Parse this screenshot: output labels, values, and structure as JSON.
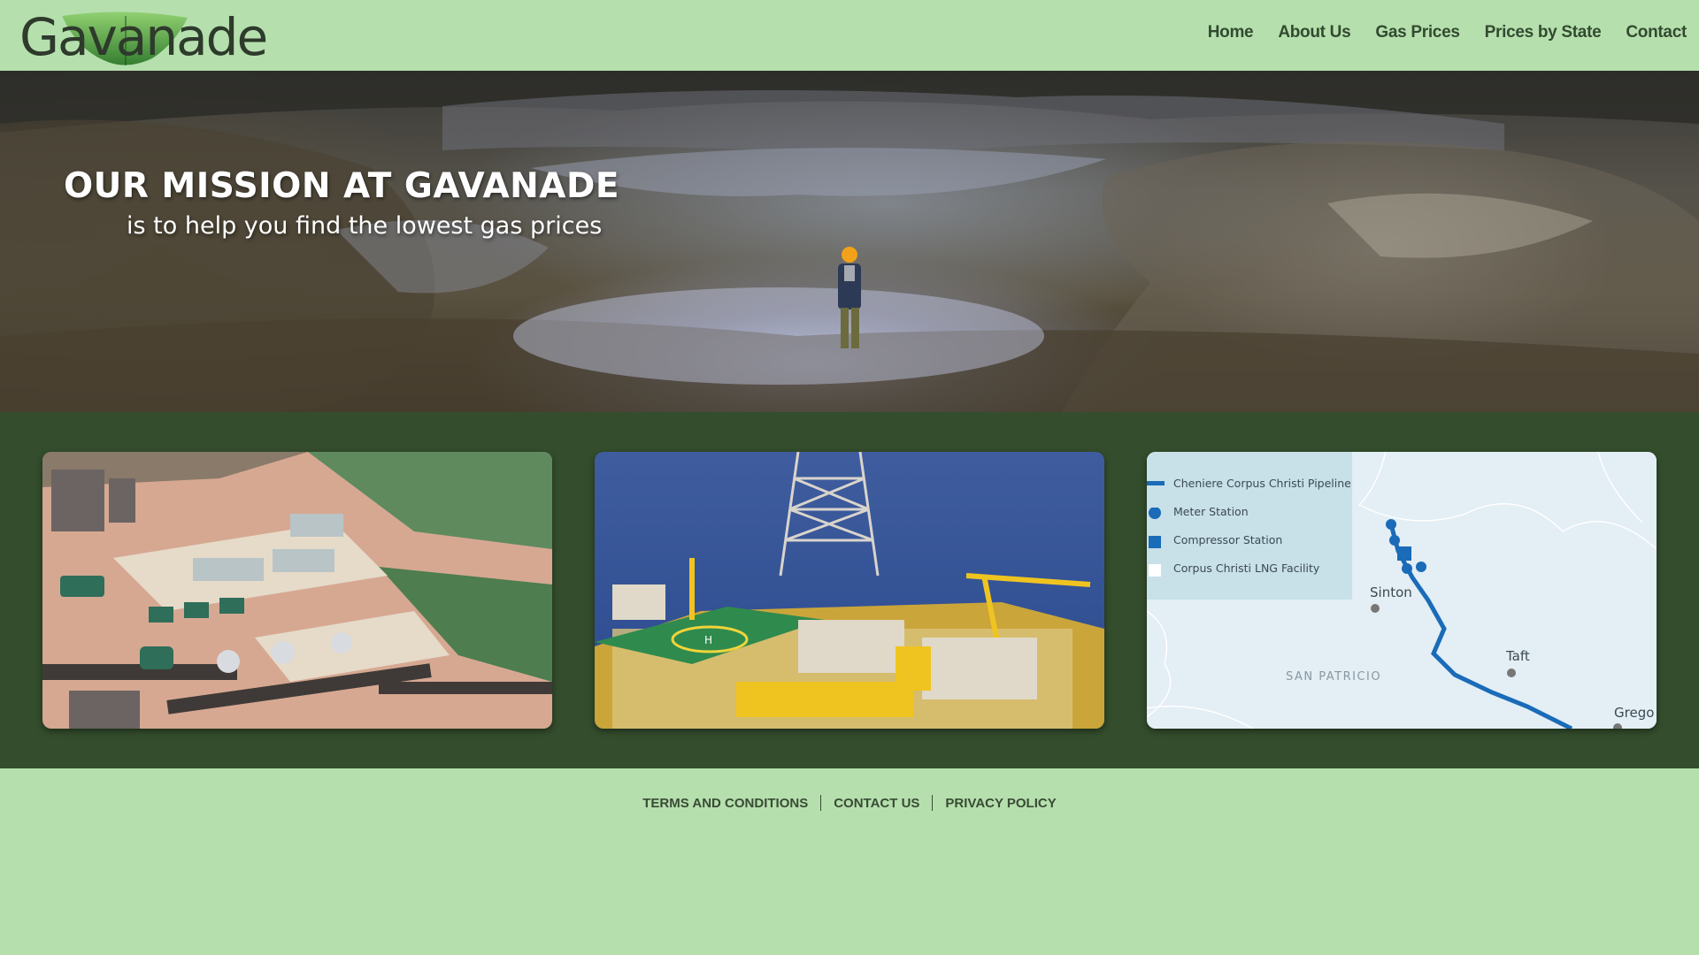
{
  "brand": {
    "logo_text": "Gavanade"
  },
  "nav": {
    "items": [
      {
        "label": "Home"
      },
      {
        "label": "About Us"
      },
      {
        "label": "Gas Prices"
      },
      {
        "label": "Prices by State"
      },
      {
        "label": "Contact"
      }
    ]
  },
  "hero": {
    "title": "OUR MISSION AT GAVANADE",
    "subtitle": "is to help you find the lowest gas prices"
  },
  "cards": {
    "map": {
      "legend": [
        {
          "label": "Cheniere Corpus Christi Pipeline",
          "symbol": "line-icon"
        },
        {
          "label": "Meter Station",
          "symbol": "circle-icon"
        },
        {
          "label": "Compressor Station",
          "symbol": "square-icon"
        },
        {
          "label": "Corpus Christi LNG Facility",
          "symbol": "white-square-icon"
        }
      ],
      "places": {
        "sinton": "Sinton",
        "taft": "Taft",
        "gregory": "Grego"
      },
      "county": "SAN PATRICIO",
      "pipeline_color": "#1a6bb8"
    }
  },
  "footer": {
    "links": [
      {
        "label": "TERMS AND CONDITIONS"
      },
      {
        "label": "CONTACT US"
      },
      {
        "label": "PRIVACY POLICY"
      }
    ]
  },
  "colors": {
    "header_bg": "#b5e0ad",
    "section_bg": "#344e2d",
    "nav_text": "#334a31"
  }
}
